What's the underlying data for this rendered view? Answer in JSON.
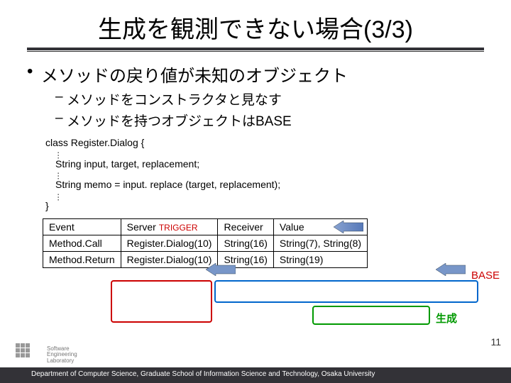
{
  "title": "生成を観測できない場合(3/3)",
  "bullets": {
    "b1": "メソッドの戻り値が未知のオブジェクト",
    "b2a": "メソッドをコンストラクタと見なす",
    "b2b": "メソッドを持つオブジェクトはBASE"
  },
  "code": {
    "decl": "class Register.Dialog {",
    "l1": "String input, target, replacement;",
    "l2": "String memo = input. replace (target, replacement);",
    "close": "}"
  },
  "table": {
    "h_event": "Event",
    "h_server": "Server",
    "h_receiver": "Receiver",
    "h_value": "Value",
    "r1_event": "Method.Call",
    "r1_server": "Register.Dialog(10)",
    "r1_receiver": "String(16)",
    "r1_value": "String(7), String(8)",
    "r2_event": "Method.Return",
    "r2_server": "Register.Dialog(10)",
    "r2_receiver": "String(16)",
    "r2_value": "String(19)"
  },
  "labels": {
    "trigger": "TRIGGER",
    "base": "BASE",
    "gen": "生成"
  },
  "page": "11",
  "footer": "Department of Computer Science, Graduate School of Information Science and Technology, Osaka University",
  "logo": {
    "l1": "Software",
    "l2": "Engineering",
    "l3": "Laboratory"
  }
}
